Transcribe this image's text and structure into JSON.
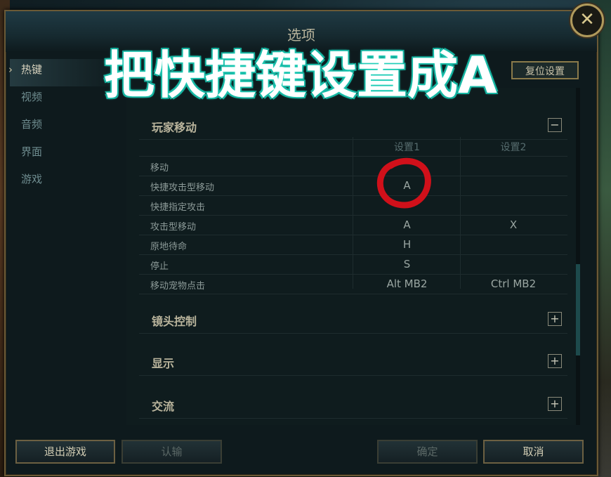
{
  "window": {
    "title": "选项"
  },
  "overlay_caption": "把快捷键设置成A",
  "sidebar": {
    "items": [
      {
        "label": "热键",
        "active": true
      },
      {
        "label": "视频",
        "active": false
      },
      {
        "label": "音频",
        "active": false
      },
      {
        "label": "界面",
        "active": false
      },
      {
        "label": "游戏",
        "active": false
      }
    ]
  },
  "restore_button": {
    "label": "复位设置"
  },
  "sections": [
    {
      "label": "玩家移动",
      "expanded": true,
      "toggle": "−"
    },
    {
      "label": "镜头控制",
      "expanded": false,
      "toggle": "+"
    },
    {
      "label": "显示",
      "expanded": false,
      "toggle": "+"
    },
    {
      "label": "交流",
      "expanded": false,
      "toggle": "+"
    }
  ],
  "keybind_table": {
    "columns": [
      "设置1",
      "设置2"
    ],
    "rows": [
      {
        "action": "移动",
        "slot1": "",
        "slot2": ""
      },
      {
        "action": "快捷攻击型移动",
        "slot1": "A",
        "slot2": ""
      },
      {
        "action": "快捷指定攻击",
        "slot1": "",
        "slot2": ""
      },
      {
        "action": "攻击型移动",
        "slot1": "A",
        "slot2": "X"
      },
      {
        "action": "原地待命",
        "slot1": "H",
        "slot2": ""
      },
      {
        "action": "停止",
        "slot1": "S",
        "slot2": ""
      },
      {
        "action": "移动宠物点击",
        "slot1": "Alt  MB2",
        "slot2": "Ctrl  MB2"
      }
    ]
  },
  "footer": {
    "exit_label": "退出游戏",
    "surrender_label": "认输",
    "ok_label": "确定",
    "cancel_label": "取消"
  },
  "colors": {
    "accent_gold": "#b09a5c",
    "highlight_red": "#d0101a",
    "caption_glow": "#29e0c8"
  },
  "icons": {
    "close": "close-icon",
    "collapse": "minus-icon",
    "expand": "plus-icon"
  }
}
